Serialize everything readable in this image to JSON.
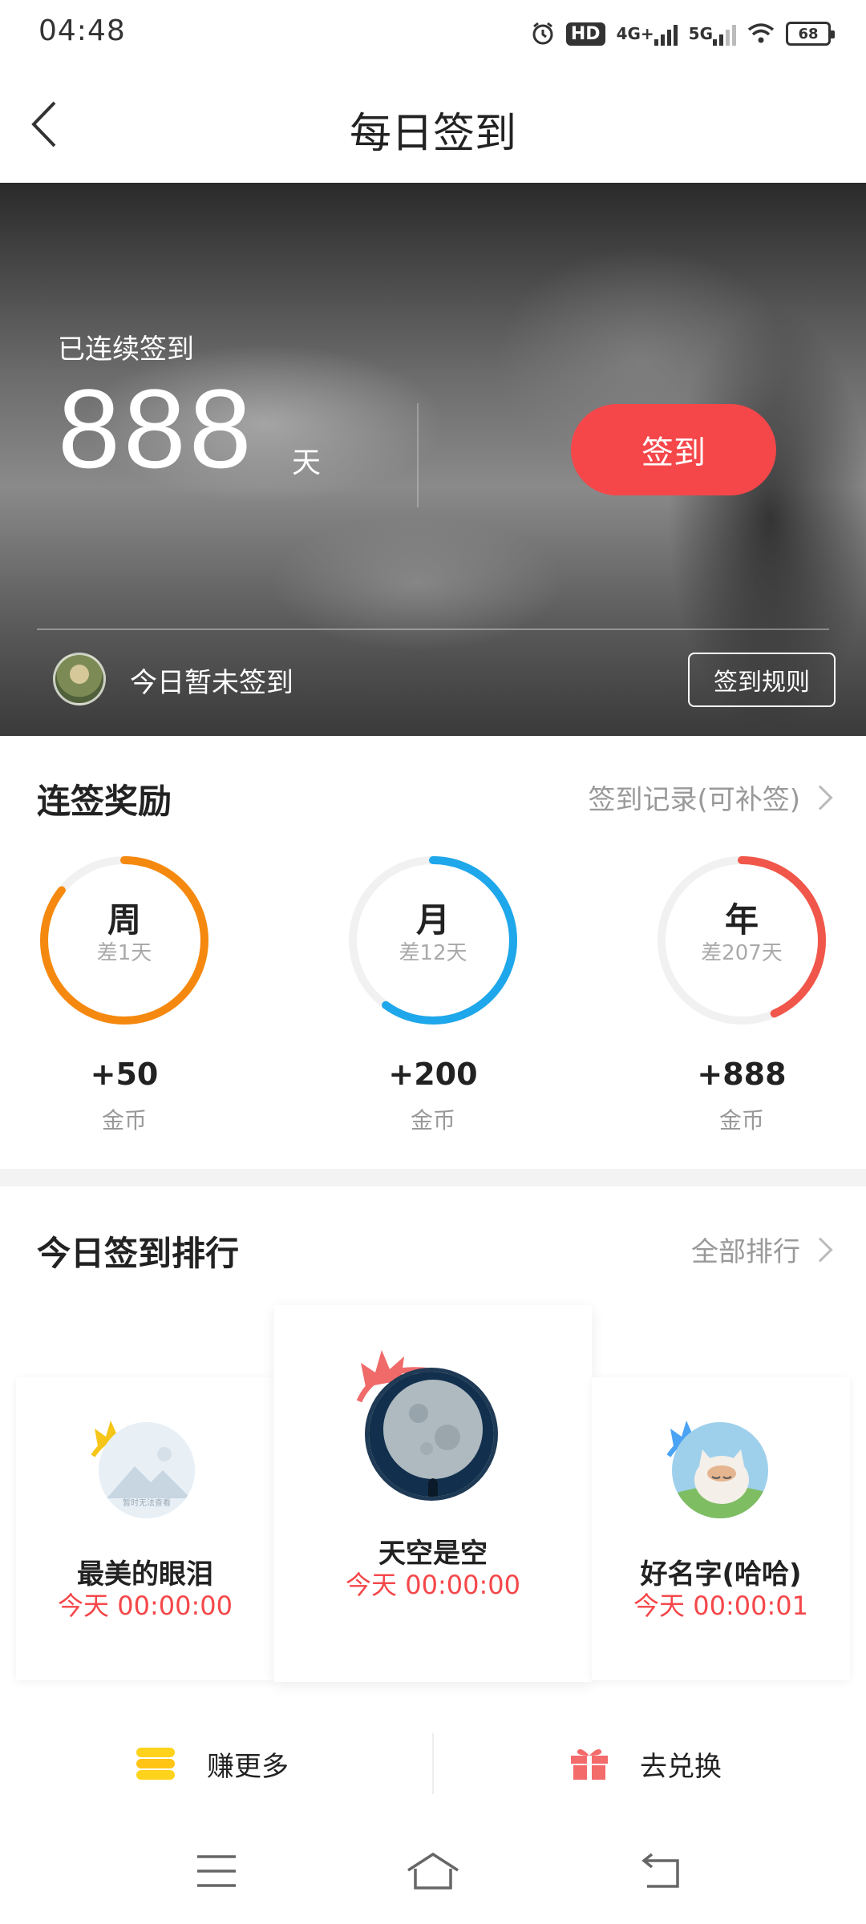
{
  "status_bar": {
    "time": "04:48",
    "hd_label": "HD",
    "net1": "4G+",
    "net2": "5G",
    "battery": "68",
    "icons": [
      "alarm-icon",
      "hd-icon",
      "signal-4g-icon",
      "signal-5g-icon",
      "wifi-icon",
      "battery-icon"
    ]
  },
  "header": {
    "title": "每日签到",
    "back_icon": "chevron-left-icon"
  },
  "hero": {
    "streak_label": "已连续签到",
    "streak_value": "888",
    "streak_unit": "天",
    "checkin_button": "签到",
    "status_text": "今日暂未签到",
    "rules_button": "签到规则"
  },
  "rewards": {
    "title": "连签奖励",
    "record_link": "签到记录(可补签)",
    "items": [
      {
        "label": "周",
        "sub": "差1天",
        "reward": "+50",
        "unit": "金币",
        "color": "#f5890f",
        "progress": 0.857
      },
      {
        "label": "月",
        "sub": "差12天",
        "reward": "+200",
        "unit": "金币",
        "color": "#1ea7ea",
        "progress": 0.6
      },
      {
        "label": "年",
        "sub": "差207天",
        "reward": "+888",
        "unit": "金币",
        "color": "#f0574a",
        "progress": 0.433
      }
    ]
  },
  "ranking": {
    "title": "今日签到排行",
    "all_link": "全部排行",
    "entries": [
      {
        "name": "最美的眼泪",
        "time": "今天 00:00:00",
        "crown_color": "#f5c518",
        "avatar_text": "暂时无法查看"
      },
      {
        "name": "天空是空",
        "time": "今天 00:00:00",
        "crown_color": "#f06a6a"
      },
      {
        "name": "好名字(哈哈)",
        "time": "今天 00:00:01",
        "crown_color": "#4aa3f5"
      }
    ]
  },
  "actions": {
    "earn_more": "赚更多",
    "exchange": "去兑换",
    "earn_icon": "coins-icon",
    "exchange_icon": "gift-icon"
  },
  "nav": {
    "menu_icon": "menu-icon",
    "home_icon": "home-icon",
    "back_icon": "return-icon"
  },
  "colors": {
    "accent_red": "#f5474a",
    "week_orange": "#f5890f",
    "month_blue": "#1ea7ea",
    "year_red": "#f0574a"
  }
}
